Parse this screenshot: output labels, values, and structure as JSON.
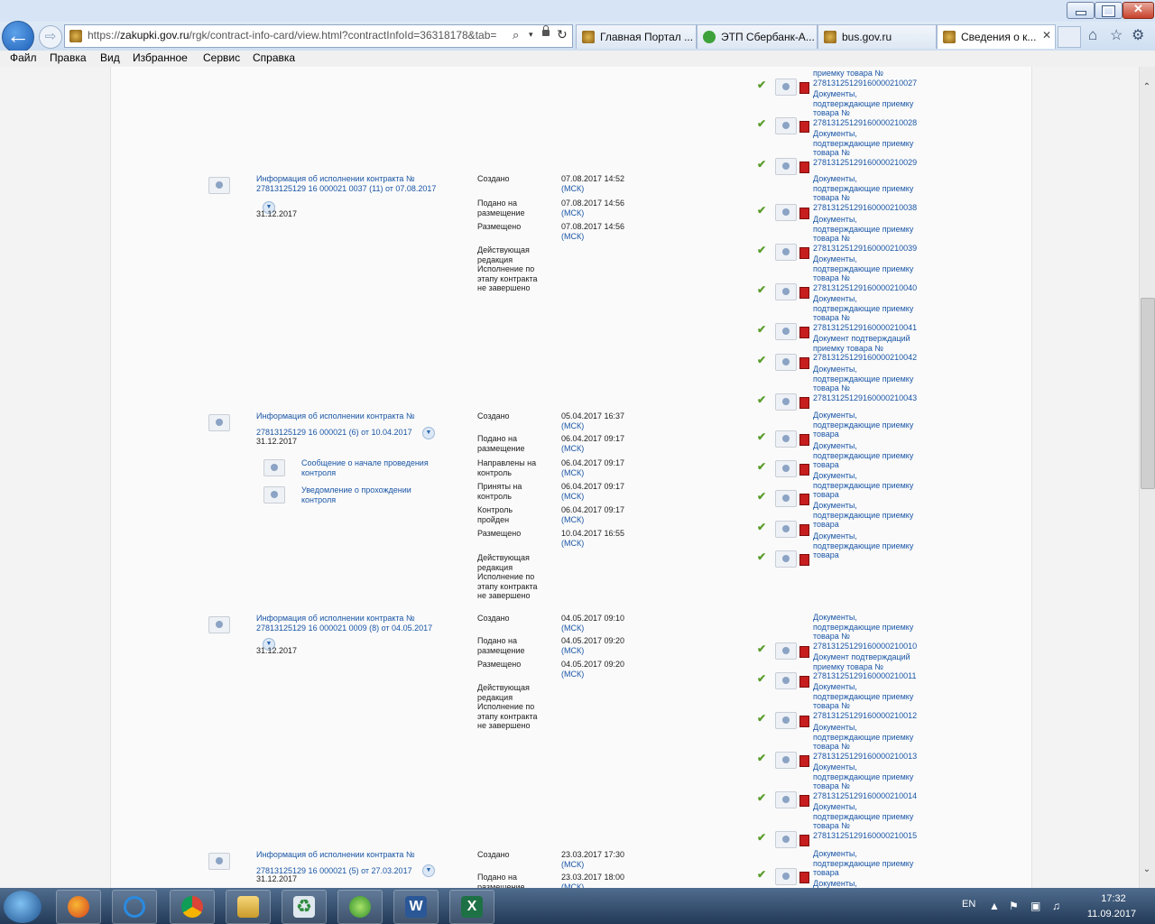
{
  "browser": {
    "url_prefix": "https://",
    "url_host": "zakupki.gov.ru",
    "url_path": "/rgk/contract-info-card/view.html?contractInfoId=36318178&tab=",
    "tabs": [
      {
        "label": "Главная Портал ..."
      },
      {
        "label": "ЭТП Сбербанк-А..."
      },
      {
        "label": "bus.gov.ru"
      },
      {
        "label": "Сведения о к..."
      }
    ]
  },
  "menu": [
    "Файл",
    "Правка",
    "Вид",
    "Избранное",
    "Сервис",
    "Справка"
  ],
  "page": {
    "top_docs": [
      {
        "lines": [
          "приемку товара №",
          "27813125129160000210027"
        ]
      },
      {
        "lines": [
          "Документы,",
          "подтверждающие приемку",
          "товара №",
          "27813125129160000210028"
        ]
      },
      {
        "lines": [
          "Документы,",
          "подтверждающие приемку",
          "товара №",
          "27813125129160000210029"
        ]
      }
    ],
    "records": [
      {
        "title_1": "Информация об исполнении контракта №",
        "title_2": "27813125129 16 000021 0037 (11) от 07.08.2017",
        "date": "31.12.2017",
        "sub_items": [],
        "status": [
          {
            "label": [
              "Создано"
            ],
            "date": "07.08.2017 14:52",
            "tz": "(МСК)"
          },
          {
            "label": [
              "Подано на",
              "размещение"
            ],
            "date": "07.08.2017 14:56",
            "tz": "(МСК)"
          },
          {
            "label": [
              "Размещено"
            ],
            "date": "07.08.2017 14:56",
            "tz": "(МСК)"
          },
          {
            "label": [
              "Действующая",
              "редакция",
              "Исполнение по",
              "этапу контракта",
              "не завершено"
            ],
            "date": "",
            "tz": ""
          }
        ],
        "docs": [
          {
            "lines": [
              "Документы,",
              "подтверждающие приемку",
              "товара №",
              "27813125129160000210038"
            ]
          },
          {
            "lines": [
              "Документы,",
              "подтверждающие приемку",
              "товара №",
              "27813125129160000210039"
            ]
          },
          {
            "lines": [
              "Документы,",
              "подтверждающие приемку",
              "товара №",
              "27813125129160000210040"
            ]
          },
          {
            "lines": [
              "Документы,",
              "подтверждающие приемку",
              "товара №",
              "27813125129160000210041"
            ]
          },
          {
            "lines": [
              "Документ подтверждаций",
              "приемку товара №",
              "27813125129160000210042"
            ]
          },
          {
            "lines": [
              "Документы,",
              "подтверждающие приемку",
              "товара №",
              "27813125129160000210043"
            ]
          }
        ]
      },
      {
        "title_1": "Информация об исполнении контракта №",
        "title_2": "27813125129 16 000021 (6) от 10.04.2017",
        "date": "31.12.2017",
        "sub_items": [
          {
            "lines": [
              "Сообщение о начале проведения",
              "контроля"
            ]
          },
          {
            "lines": [
              "Уведомление о прохождении",
              "контроля"
            ]
          }
        ],
        "status": [
          {
            "label": [
              "Создано"
            ],
            "date": "05.04.2017 16:37",
            "tz": "(МСК)"
          },
          {
            "label": [
              "Подано на",
              "размещение"
            ],
            "date": "06.04.2017 09:17",
            "tz": "(МСК)"
          },
          {
            "label": [
              "Направлены на",
              "контроль"
            ],
            "date": "06.04.2017 09:17",
            "tz": "(МСК)"
          },
          {
            "label": [
              "Приняты на",
              "контроль"
            ],
            "date": "06.04.2017 09:17",
            "tz": "(МСК)"
          },
          {
            "label": [
              "Контроль",
              "пройден"
            ],
            "date": "06.04.2017 09:17",
            "tz": "(МСК)"
          },
          {
            "label": [
              "Размещено"
            ],
            "date": "10.04.2017 16:55",
            "tz": "(МСК)"
          },
          {
            "label": [
              "Действующая",
              "редакция",
              "Исполнение по",
              "этапу контракта",
              "не завершено"
            ],
            "date": "",
            "tz": ""
          }
        ],
        "docs": [
          {
            "lines": [
              "Документы,",
              "подтверждающие приемку",
              "товара"
            ]
          },
          {
            "lines": [
              "Документы,",
              "подтверждающие приемку",
              "товара"
            ]
          },
          {
            "lines": [
              "Документы,",
              "подтверждающие приемку",
              "товара"
            ]
          },
          {
            "lines": [
              "Документы,",
              "подтверждающие приемку",
              "товара"
            ]
          },
          {
            "lines": [
              "Документы,",
              "подтверждающие приемку",
              "товара"
            ]
          }
        ]
      },
      {
        "title_1": "Информация об исполнении контракта №",
        "title_2": "27813125129 16 000021 0009 (8) от 04.05.2017",
        "date": "31.12.2017",
        "sub_items": [],
        "status": [
          {
            "label": [
              "Создано"
            ],
            "date": "04.05.2017 09:10",
            "tz": "(МСК)"
          },
          {
            "label": [
              "Подано на",
              "размещение"
            ],
            "date": "04.05.2017 09:20",
            "tz": "(МСК)"
          },
          {
            "label": [
              "Размещено"
            ],
            "date": "04.05.2017 09:20",
            "tz": "(МСК)"
          },
          {
            "label": [
              "Действующая",
              "редакция",
              "Исполнение по",
              "этапу контракта",
              "не завершено"
            ],
            "date": "",
            "tz": ""
          }
        ],
        "docs": [
          {
            "lines": [
              "Документы,",
              "подтверждающие приемку",
              "товара №",
              "27813125129160000210010"
            ]
          },
          {
            "lines": [
              "Документ подтверждаций",
              "приемку товара №",
              "27813125129160000210011"
            ]
          },
          {
            "lines": [
              "Документы,",
              "подтверждающие приемку",
              "товара №",
              "27813125129160000210012"
            ]
          },
          {
            "lines": [
              "Документы,",
              "подтверждающие приемку",
              "товара №",
              "27813125129160000210013"
            ]
          },
          {
            "lines": [
              "Документы,",
              "подтверждающие приемку",
              "товара №",
              "27813125129160000210014"
            ]
          },
          {
            "lines": [
              "Документы,",
              "подтверждающие приемку",
              "товара №",
              "27813125129160000210015"
            ]
          }
        ]
      },
      {
        "title_1": "Информация об исполнении контракта №",
        "title_2": "27813125129 16 000021 (5) от 27.03.2017",
        "date": "31.12.2017",
        "sub_items": [],
        "status": [
          {
            "label": [
              "Создано"
            ],
            "date": "23.03.2017 17:30",
            "tz": "(МСК)"
          },
          {
            "label": [
              "Подано на",
              "размещение"
            ],
            "date": "23.03.2017 18:00",
            "tz": "(МСК)"
          }
        ],
        "docs": [
          {
            "lines": [
              "Документы,",
              "подтверждающие приемку",
              "товара"
            ]
          },
          {
            "lines": [
              "Документы,"
            ]
          }
        ]
      }
    ]
  },
  "taskbar": {
    "lang": "EN",
    "time": "17:32",
    "date": "11.09.2017",
    "apps": [
      "firefox",
      "internet-explorer",
      "chrome",
      "file-explorer",
      "recycle",
      "qip",
      "word",
      "excel"
    ]
  }
}
